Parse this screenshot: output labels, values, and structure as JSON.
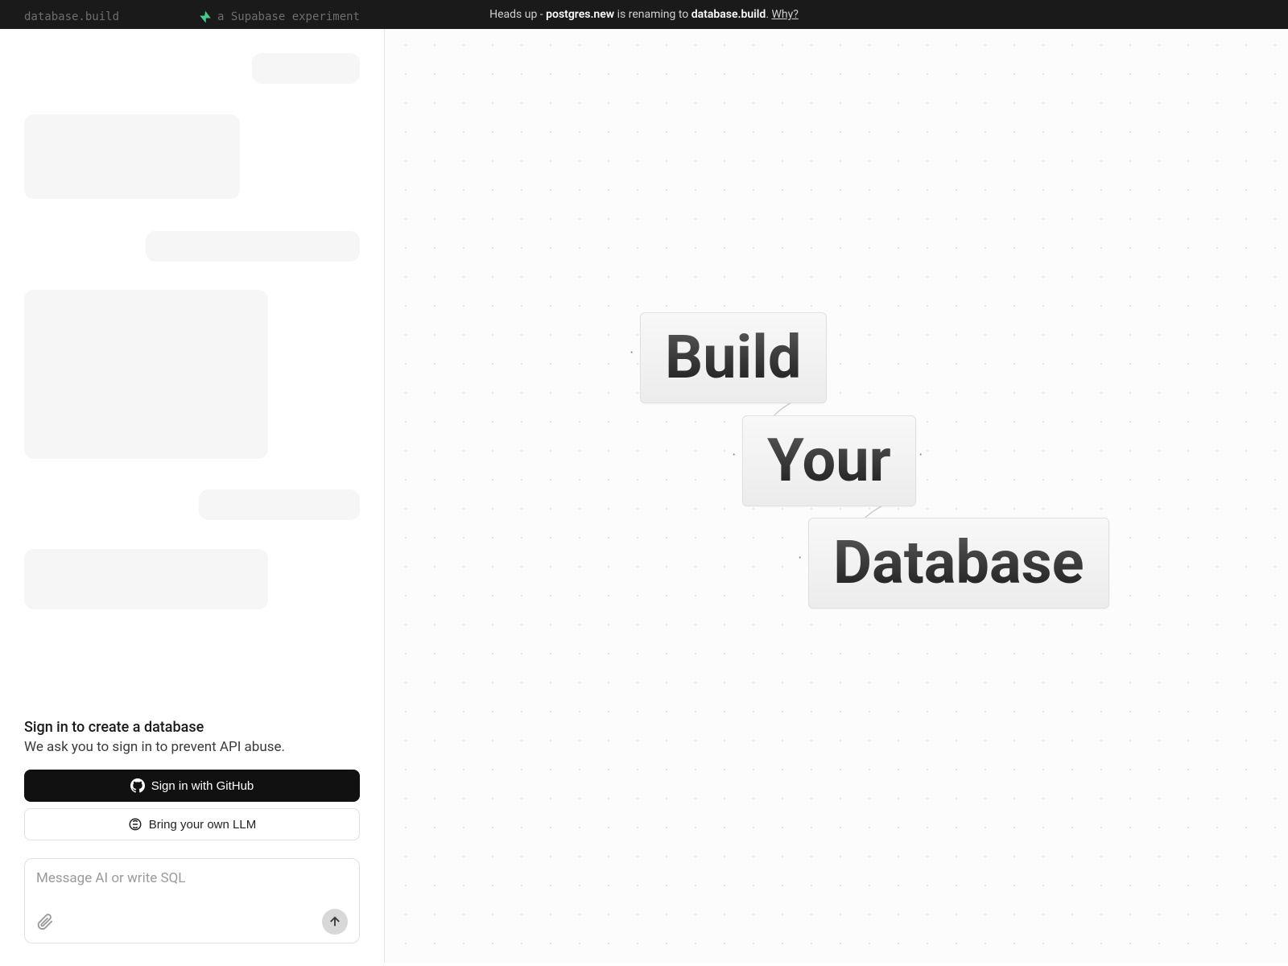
{
  "banner": {
    "prefix": "Heads up - ",
    "old_name": "postgres.new",
    "middle": " is renaming to ",
    "new_name": "database.build",
    "suffix": ". ",
    "link_text": "Why?"
  },
  "header": {
    "brand": "database.build",
    "experiment_label": "a Supabase experiment"
  },
  "signin": {
    "title": "Sign in to create a database",
    "subtitle": "We ask you to sign in to prevent API abuse.",
    "github_button": "Sign in with GitHub",
    "byollm_button": "Bring your own LLM"
  },
  "input": {
    "placeholder": "Message AI or write SQL"
  },
  "canvas": {
    "word1": "Build",
    "word2": "Your",
    "word3": "Database"
  }
}
